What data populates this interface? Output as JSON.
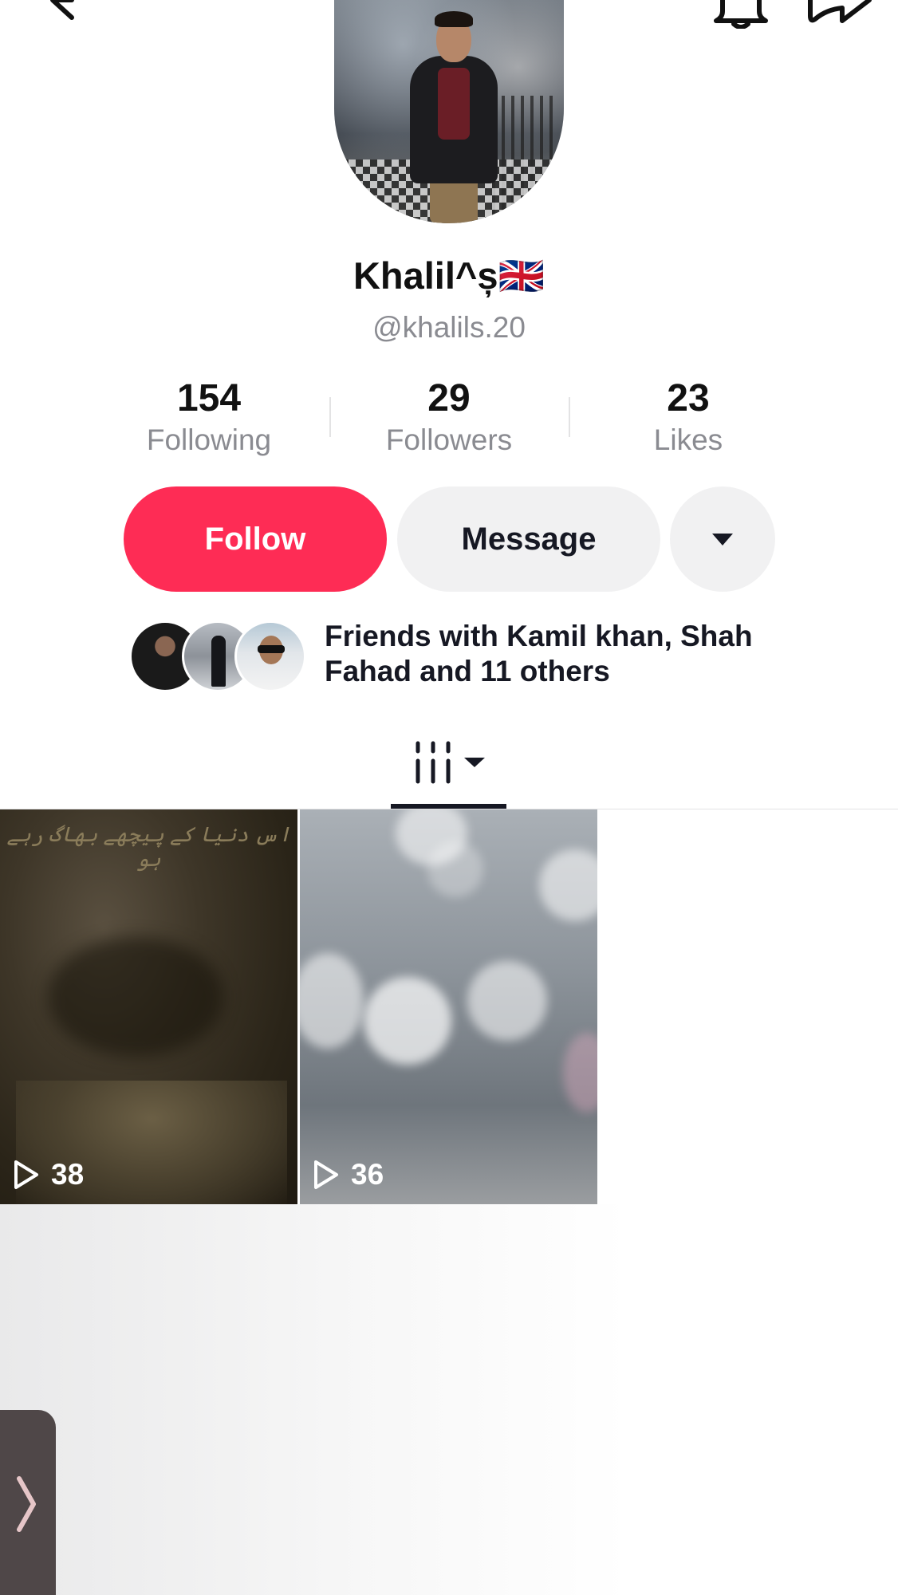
{
  "profile": {
    "display_name": "Khalil^ș🇬🇧",
    "handle": "@khalils.20",
    "stats": [
      {
        "value": "154",
        "label": "Following"
      },
      {
        "value": "29",
        "label": "Followers"
      },
      {
        "value": "23",
        "label": "Likes"
      }
    ]
  },
  "actions": {
    "follow_label": "Follow",
    "message_label": "Message"
  },
  "friends": {
    "text": "Friends with Kamil khan, Shah Fahad and 11 others"
  },
  "videos": [
    {
      "plays": "38",
      "caption": "اس دنیا کے پیچھے بھاگ رہے ہو"
    },
    {
      "plays": "36"
    }
  ],
  "colors": {
    "accent": "#fe2c55",
    "secondary_button": "#f1f1f2",
    "muted_text": "#8a8b91"
  },
  "icons": {
    "back": "back-arrow-icon",
    "bell": "bell-icon",
    "share": "share-icon",
    "grid_tab": "grid-tab-icon",
    "more": "triangle-down-icon",
    "play": "play-icon",
    "side": "chevron-right-icon"
  }
}
